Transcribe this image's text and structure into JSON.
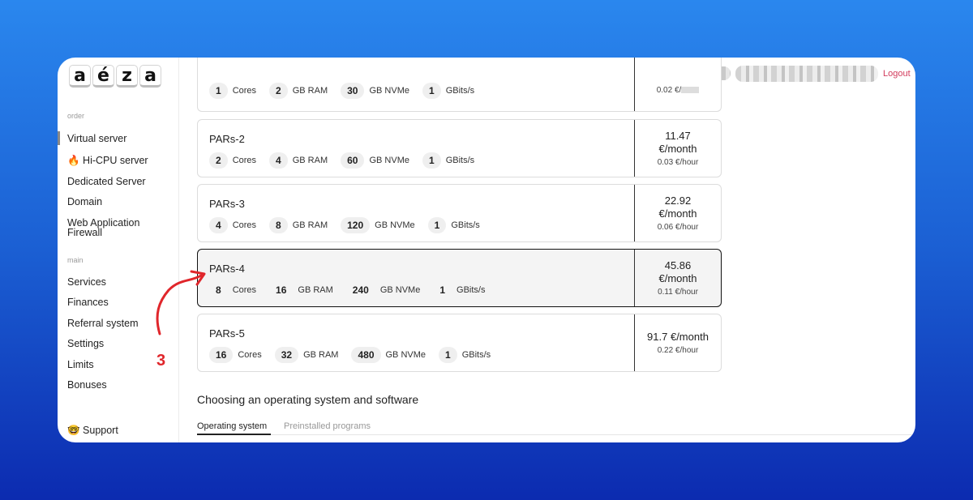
{
  "logo": [
    "a",
    "é",
    "z",
    "a"
  ],
  "sidebar": {
    "order_label": "order",
    "order_items": [
      {
        "label": "Virtual server"
      },
      {
        "label": "🔥 Hi-CPU server"
      },
      {
        "label": "Dedicated Server"
      },
      {
        "label": "Domain"
      },
      {
        "label": "Web Application Firewall"
      }
    ],
    "main_label": "main",
    "main_items": [
      {
        "label": "Services"
      },
      {
        "label": "Finances"
      },
      {
        "label": "Referral system"
      },
      {
        "label": "Settings"
      },
      {
        "label": "Limits"
      },
      {
        "label": "Bonuses"
      }
    ],
    "support": "🤓 Support"
  },
  "header": {
    "logout": "Logout"
  },
  "spec_units": {
    "cores": "Cores",
    "ram": "GB RAM",
    "disk": "GB NVMe",
    "net": "GBits/s"
  },
  "plans": [
    {
      "name": "",
      "cores": "1",
      "ram": "2",
      "disk": "30",
      "net": "1",
      "month": "",
      "hour": "0.02 €/"
    },
    {
      "name": "PARs-2",
      "cores": "2",
      "ram": "4",
      "disk": "60",
      "net": "1",
      "month": "11.47 €/month",
      "hour": "0.03 €/hour"
    },
    {
      "name": "PARs-3",
      "cores": "4",
      "ram": "8",
      "disk": "120",
      "net": "1",
      "month": "22.92 €/month",
      "hour": "0.06 €/hour"
    },
    {
      "name": "PARs-4",
      "cores": "8",
      "ram": "16",
      "disk": "240",
      "net": "1",
      "month": "45.86 €/month",
      "hour": "0.11 €/hour"
    },
    {
      "name": "PARs-5",
      "cores": "16",
      "ram": "32",
      "disk": "480",
      "net": "1",
      "month": "91.7 €/month",
      "hour": "0.22 €/hour"
    }
  ],
  "os_section": {
    "title": "Choosing an operating system and software",
    "tabs": [
      "Operating system",
      "Preinstalled programs"
    ]
  },
  "annotation": {
    "number": "3",
    "color": "#e0262b"
  }
}
